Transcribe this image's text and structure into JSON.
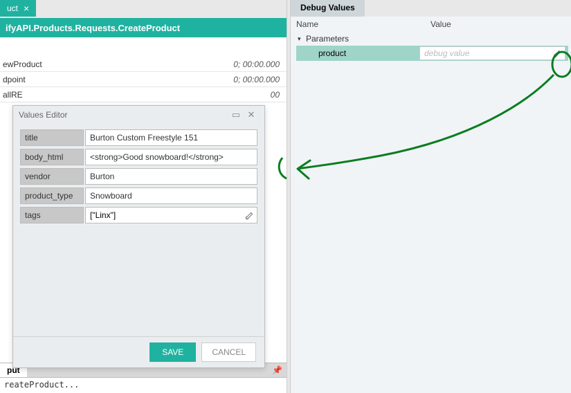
{
  "left": {
    "tab": {
      "label": "uct",
      "close": "×"
    },
    "breadcrumb": "ifyAPI.Products.Requests.CreateProduct",
    "rows": [
      {
        "name": "ewProduct",
        "time": "0; 00:00.000"
      },
      {
        "name": "dpoint",
        "time": "0; 00:00.000"
      },
      {
        "name": "allRE",
        "time": "00"
      }
    ]
  },
  "modal": {
    "title": "Values Editor",
    "fields": [
      {
        "label": "title",
        "value": "Burton Custom Freestyle 151"
      },
      {
        "label": "body_html",
        "value": "<strong>Good snowboard!</strong>"
      },
      {
        "label": "vendor",
        "value": "Burton"
      },
      {
        "label": "product_type",
        "value": "Snowboard"
      },
      {
        "label": "tags",
        "value": "[\"Linx\"]"
      }
    ],
    "save": "SAVE",
    "cancel": "CANCEL"
  },
  "output": {
    "tab": "put",
    "text": "reateProduct..."
  },
  "right": {
    "tab": "Debug Values",
    "col_name": "Name",
    "col_value": "Value",
    "group": "Parameters",
    "param_name": "product",
    "param_placeholder": "debug value"
  }
}
